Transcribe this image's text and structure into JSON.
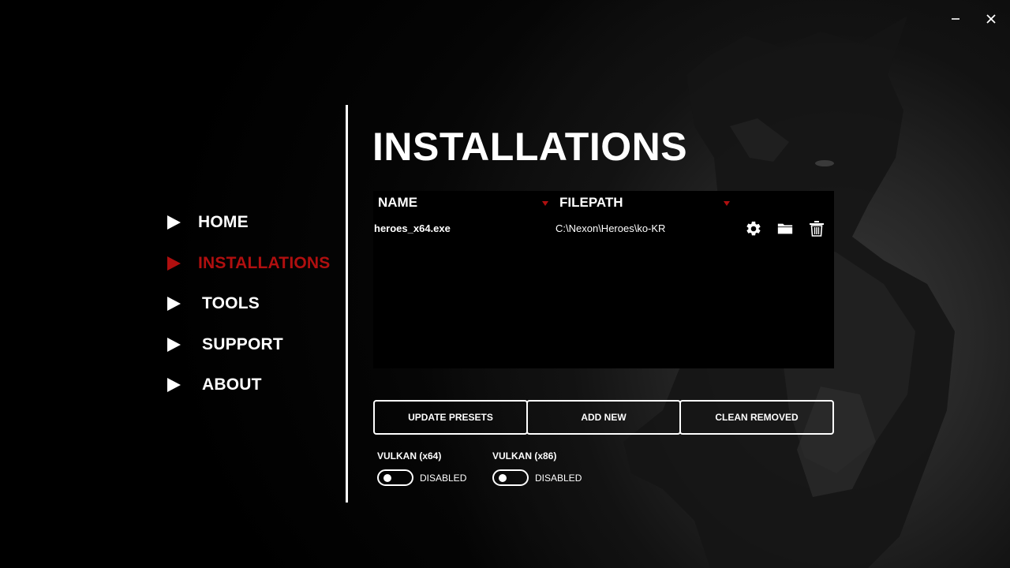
{
  "window": {
    "minimize_icon": "minimize-icon",
    "close_icon": "close-icon"
  },
  "nav": {
    "items": [
      {
        "label": "HOME",
        "icon": "play-arrow-icon",
        "active": false
      },
      {
        "label": "INSTALLATIONS",
        "icon": "play-arrow-icon",
        "active": true
      },
      {
        "label": "TOOLS",
        "icon": "play-arrow-icon",
        "active": false
      },
      {
        "label": "SUPPORT",
        "icon": "play-arrow-icon",
        "active": false
      },
      {
        "label": "ABOUT",
        "icon": "play-arrow-icon",
        "active": false
      }
    ]
  },
  "page": {
    "title": "INSTALLATIONS"
  },
  "table": {
    "columns": [
      "NAME",
      "FILEPATH"
    ],
    "rows": [
      {
        "name": "heroes_x64.exe",
        "filepath": "C:\\Nexon\\Heroes\\ko-KR",
        "actions": [
          "gear-icon",
          "folder-icon",
          "trash-icon"
        ]
      }
    ]
  },
  "buttons": {
    "update_presets": "UPDATE PRESETS",
    "add_new": "ADD NEW",
    "clean_removed": "CLEAN REMOVED"
  },
  "toggles": [
    {
      "title": "VULKAN (x64)",
      "state": "DISABLED",
      "on": false
    },
    {
      "title": "VULKAN (x86)",
      "state": "DISABLED",
      "on": false
    }
  ],
  "colors": {
    "accent": "#b00f0f",
    "background": "#000000",
    "text": "#ffffff"
  }
}
